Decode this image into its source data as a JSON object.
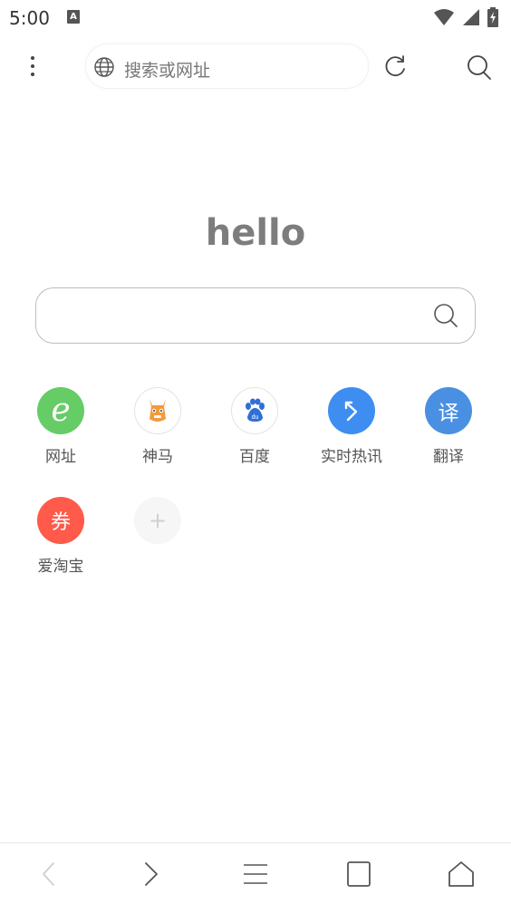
{
  "status_bar": {
    "time": "5:00",
    "notification_icon": "A"
  },
  "top_bar": {
    "url_placeholder": "搜索或网址"
  },
  "home": {
    "greeting": "hello"
  },
  "shortcuts": [
    {
      "label": "网址",
      "glyph": "e",
      "color": "#66cc66"
    },
    {
      "label": "神马",
      "glyph": "",
      "color": "#ffffff"
    },
    {
      "label": "百度",
      "glyph": "du",
      "color": "#ffffff"
    },
    {
      "label": "实时热讯",
      "glyph": "",
      "color": "#3d8ef0"
    },
    {
      "label": "翻译",
      "glyph": "译",
      "color": "#4a90e2"
    },
    {
      "label": "爱淘宝",
      "glyph": "券",
      "color": "#ff5a4a"
    },
    {
      "label": "",
      "glyph": "+",
      "color": "#f5f5f5"
    }
  ],
  "icons": {
    "menu": "more-vertical-icon",
    "globe": "globe-icon",
    "reload": "reload-icon",
    "search": "search-icon",
    "back": "back-arrow-icon",
    "forward": "forward-arrow-icon",
    "menu_lines": "hamburger-menu-icon",
    "tabs": "tabs-icon",
    "home": "home-icon"
  }
}
